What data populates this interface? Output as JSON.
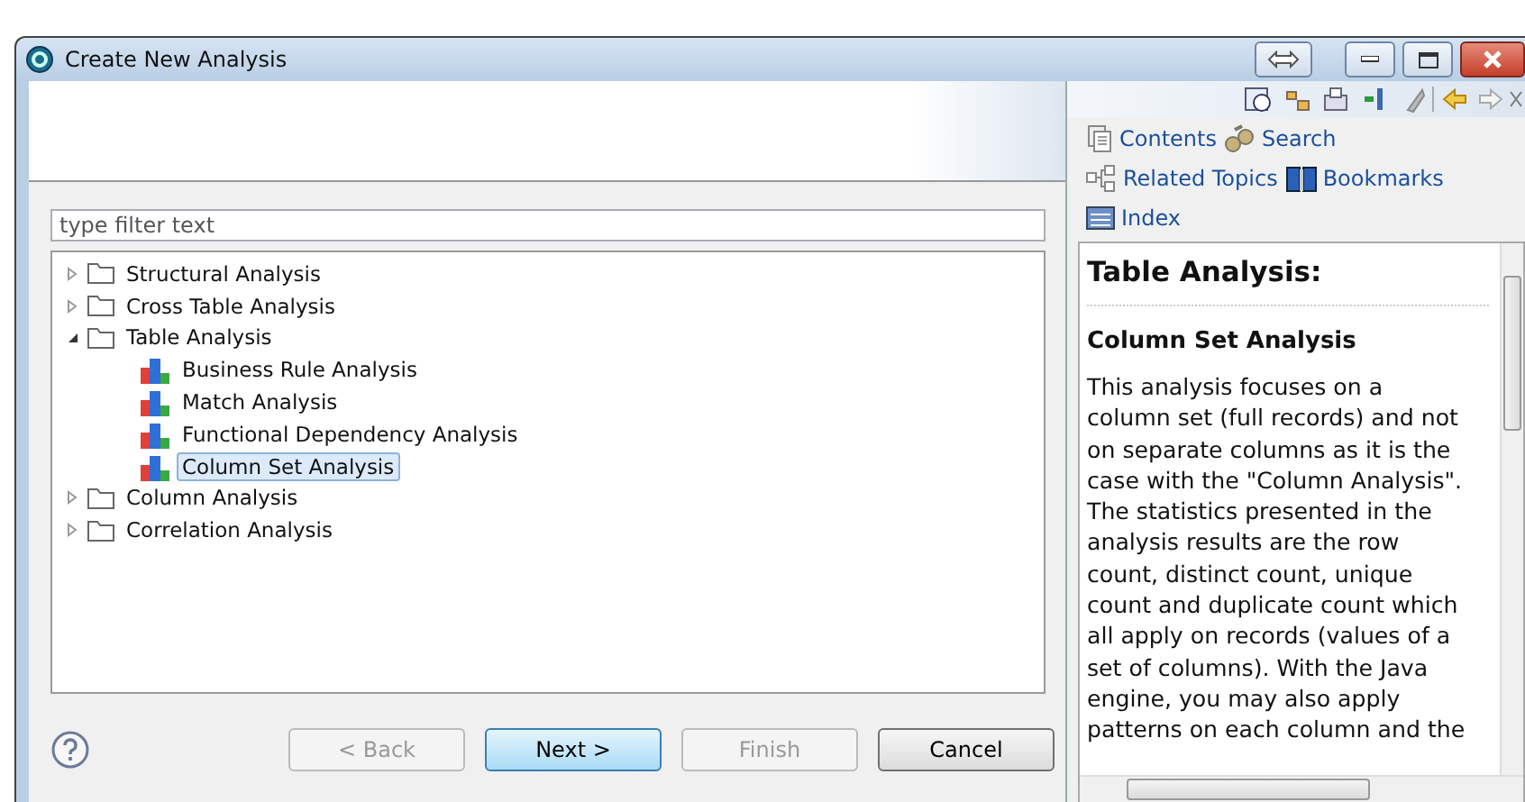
{
  "window": {
    "title": "Create New Analysis"
  },
  "filter": {
    "placeholder": "type filter text"
  },
  "tree": [
    {
      "label": "Structural Analysis",
      "kind": "folder",
      "expanded": false,
      "selected": false
    },
    {
      "label": "Cross Table Analysis",
      "kind": "folder",
      "expanded": false,
      "selected": false
    },
    {
      "label": "Table Analysis",
      "kind": "folder",
      "expanded": true,
      "selected": false,
      "children": [
        {
          "label": "Business Rule Analysis",
          "kind": "analysis",
          "selected": false
        },
        {
          "label": "Match Analysis",
          "kind": "analysis",
          "selected": false
        },
        {
          "label": "Functional Dependency Analysis",
          "kind": "analysis",
          "selected": false
        },
        {
          "label": "Column Set Analysis",
          "kind": "analysis",
          "selected": true
        }
      ]
    },
    {
      "label": "Column Analysis",
      "kind": "folder",
      "expanded": false,
      "selected": false
    },
    {
      "label": "Correlation Analysis",
      "kind": "folder",
      "expanded": false,
      "selected": false
    }
  ],
  "buttons": [
    {
      "label": "< Back",
      "disabled": true,
      "default": false
    },
    {
      "label": "Next >",
      "disabled": false,
      "default": true
    },
    {
      "label": "Finish",
      "disabled": true,
      "default": false
    },
    {
      "label": "Cancel",
      "disabled": false,
      "default": false
    }
  ],
  "help": {
    "links": [
      {
        "label": "Contents",
        "kind": "contents"
      },
      {
        "label": "Search",
        "kind": "search"
      },
      {
        "label": "Related Topics",
        "kind": "related"
      },
      {
        "label": "Bookmarks",
        "kind": "bookmarks"
      },
      {
        "label": "Index",
        "kind": "index"
      }
    ],
    "heading": "Table Analysis:",
    "subheading": "Column Set Analysis",
    "body": "This analysis focuses on a column set (full records) and not on separate columns as it is the case with the \"Column Analysis\". The statistics presented in the analysis results are the row count, distinct count, unique count and duplicate count which all apply on records (values of a set of columns). With the Java engine, you may also apply patterns on each column and the"
  }
}
